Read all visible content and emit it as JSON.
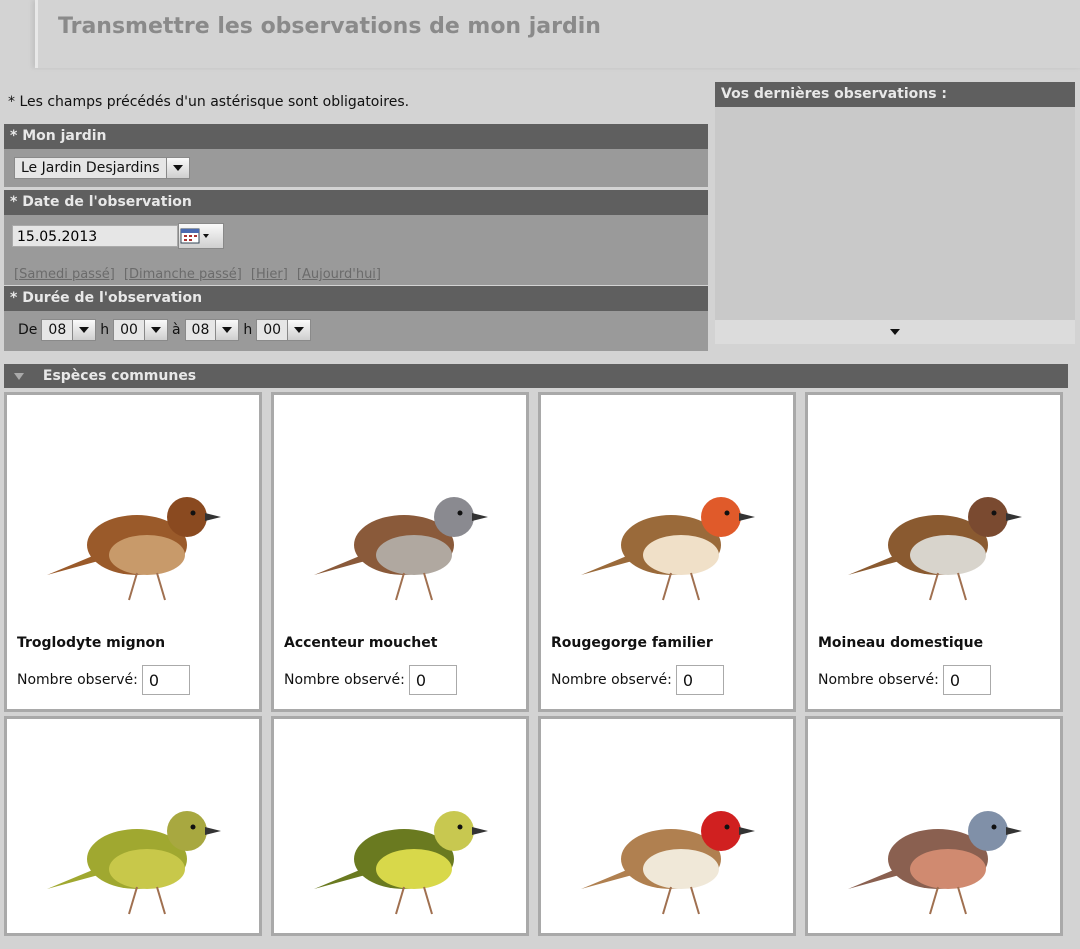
{
  "header": {
    "title": "Transmettre les observations de mon jardin"
  },
  "required_note": "* Les champs précédés d'un astérisque sont obligatoires.",
  "garden": {
    "label": "* Mon jardin",
    "value": "Le Jardin Desjardins"
  },
  "date": {
    "label": "* Date de l'observation",
    "value": "15.05.2013",
    "quick_links": [
      "[Samedi passé]",
      "[Dimanche passé]",
      "[Hier]",
      "[Aujourd'hui]"
    ]
  },
  "duration": {
    "label": "* Durée de l'observation",
    "from_label": "De",
    "h_label": "h",
    "to_label": "à",
    "from_hour": "08",
    "from_min": "00",
    "to_hour": "08",
    "to_min": "00"
  },
  "recent": {
    "title": "Vos dernières observations :"
  },
  "species_section": {
    "title": "Espèces communes"
  },
  "count_label": "Nombre observé:",
  "species": [
    {
      "name": "Troglodyte mignon",
      "count": "0",
      "colors": {
        "body": "#9a5a2a",
        "belly": "#c89a6a",
        "head": "#8a4a20"
      }
    },
    {
      "name": "Accenteur mouchet",
      "count": "0",
      "colors": {
        "body": "#8a5a3a",
        "belly": "#b0a8a0",
        "head": "#8a8a90"
      }
    },
    {
      "name": "Rougegorge familier",
      "count": "0",
      "colors": {
        "body": "#9a6a3a",
        "belly": "#f0e0c8",
        "head": "#e05a2a"
      }
    },
    {
      "name": "Moineau domestique",
      "count": "0",
      "colors": {
        "body": "#8a5a30",
        "belly": "#d8d4cc",
        "head": "#7a4a30"
      }
    },
    {
      "name": "",
      "count": "",
      "colors": {
        "body": "#a0a830",
        "belly": "#c8c84a",
        "head": "#a8a840"
      }
    },
    {
      "name": "",
      "count": "",
      "colors": {
        "body": "#6a7a20",
        "belly": "#d8d84a",
        "head": "#c8c850"
      }
    },
    {
      "name": "",
      "count": "",
      "colors": {
        "body": "#b08050",
        "belly": "#f0e8d8",
        "head": "#d02020"
      }
    },
    {
      "name": "",
      "count": "",
      "colors": {
        "body": "#8a6050",
        "belly": "#d08a70",
        "head": "#8090a8"
      }
    }
  ]
}
